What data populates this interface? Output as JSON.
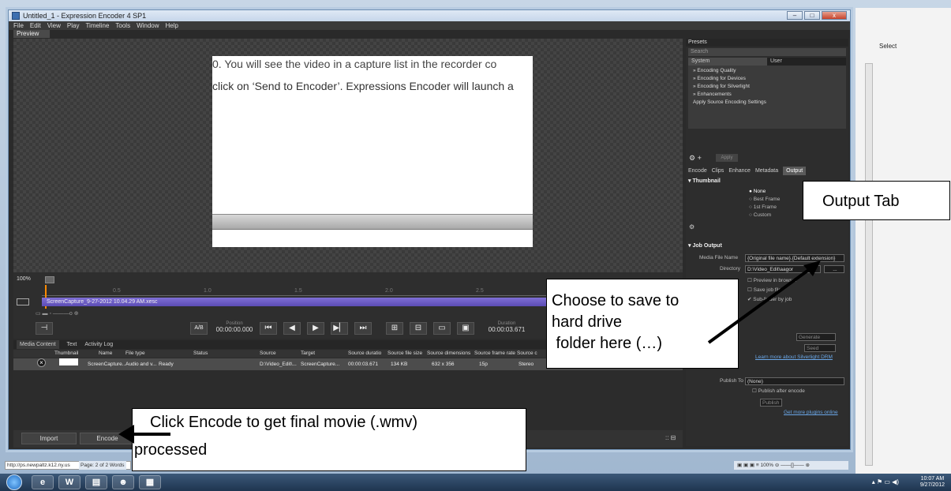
{
  "window": {
    "title": "Untitled_1 - Expression Encoder 4 SP1",
    "controls": [
      "–",
      "□",
      "x"
    ]
  },
  "menu": [
    "File",
    "Edit",
    "View",
    "Play",
    "Timeline",
    "Tools",
    "Window",
    "Help"
  ],
  "preview": {
    "tab_label": "Preview",
    "frame_text_line1": "0. You will see the video in a capture list in the recorder co",
    "frame_text_line2": "click on ‘Send to Encoder’. Expressions Encoder will launch a"
  },
  "timeline": {
    "zoom": "100%",
    "ruler_ticks": [
      "0.5",
      "1.0",
      "1.5",
      "2.0",
      "2.5"
    ],
    "clip_name": "ScreenCapture_9-27-2012 10.04.29 AM.xesc",
    "ab_label": "A/B",
    "position_label": "Position",
    "position_value": "00:00:00.000",
    "duration_label": "Duration",
    "duration_value": "00:00:03.671"
  },
  "media_content": {
    "tabs": [
      "Media Content",
      "Text",
      "Activity Log"
    ],
    "columns": [
      "Thumbnail",
      "Name",
      "File type",
      "Status",
      "Source",
      "Target",
      "Source duratio",
      "Source file size",
      "Source dimensions",
      "Source frame rate",
      "Source c"
    ],
    "row": [
      "ScreenCapture...",
      "Audio and v...",
      "Ready",
      "D:\\Video_Edit\\...",
      "ScreenCapture...",
      "00:00:03.671",
      "134 KB",
      "632 x 356",
      "15p",
      "Stereo"
    ],
    "buttons": {
      "import": "Import",
      "encode": "Encode"
    }
  },
  "right_panel": {
    "presets_title": "Presets",
    "search_placeholder": "Search",
    "preset_tabs": [
      "System",
      "User"
    ],
    "preset_items": [
      "» Encoding Quality",
      "» Encoding for Devices",
      "» Encoding for Silverlight",
      "» Enhancements",
      "Apply Source Encoding Settings"
    ],
    "apply_label": "Apply",
    "encode_tabs": [
      "Encode",
      "Clips",
      "Enhance",
      "Metadata",
      "Output"
    ],
    "thumbnail_title": "▾ Thumbnail",
    "thumbnail_options": [
      "None",
      "Best Frame",
      "1st Frame",
      "Custom"
    ],
    "job_output_title": "▾ Job Output",
    "media_file_name_label": "Media File Name",
    "media_file_name_value": "{Original file name}.{Default extension}",
    "directory_label": "Directory",
    "directory_value": "D:\\Video_Edit\\aagor",
    "browse_label": "...",
    "checks": [
      "Preview in browser",
      "Save job file",
      "Sub-folder by job"
    ],
    "drm_link": "Learn more about Silverlight DRM",
    "generate_label": "Generate",
    "seed_label": "Seed",
    "publish_label": "Publish To",
    "publish_value": "(None)",
    "publish_after": "Publish after encode",
    "publish_btn": "Publish",
    "plugins_link": "Get more plugins online"
  },
  "callouts": {
    "output_tab": "Output Tab",
    "save_folder": [
      "Choose to save to",
      "hard drive",
      " folder here (…)"
    ],
    "encode": [
      "Click Encode to get final movie (.wmv)",
      "processed"
    ]
  },
  "background": {
    "url_status": "http://ps.newpaltz.k12.ny.us",
    "word_page": "Page: 2 of 2   Words",
    "word_zoom": "100%",
    "select_label": "Select",
    "clock_time": "10:07 AM",
    "clock_date": "9/27/2012"
  },
  "taskbar_apps": [
    "e",
    "W",
    "▤",
    "☻",
    "▦"
  ]
}
